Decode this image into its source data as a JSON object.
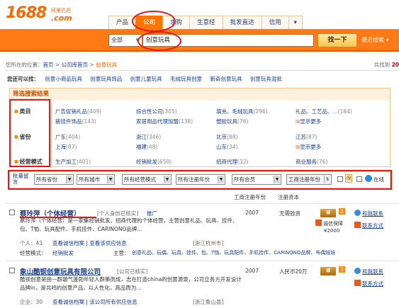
{
  "header": {
    "logo_text": "1688",
    "logo_cn": "阿里巴巴",
    "logo_com": ".com",
    "tabs": [
      "产品",
      "公司",
      "求购",
      "生意经",
      "批发直达",
      "信用",
      "▾"
    ],
    "active_tab": "公司"
  },
  "search": {
    "category": "全部",
    "query": "创意玩具",
    "button": "找一下",
    "recent": "最近搜索 ▾"
  },
  "breadcrumb": {
    "prefix": "您所在的位置：",
    "home": "首页",
    "sep1": " > ",
    "lib": "公司库首页",
    "sep2": " > ",
    "current": "创意玩具"
  },
  "total": {
    "prefix": "共找到",
    "count": "20"
  },
  "want": {
    "label": "您还可以找：",
    "items": [
      "创意小商品玩具",
      "创意玩具饰品",
      "创意儿童玩具",
      "毛绒玩具创意",
      "新奇创意玩具",
      "创意玩具混批"
    ]
  },
  "filter": {
    "title": "筛选搜索结果",
    "category": {
      "label": "类目",
      "items": [
        {
          "name": "广告促销礼品",
          "count": "(409)"
        },
        {
          "name": "综合性公司",
          "count": "(305)"
        },
        {
          "name": "填充、毛绒玩具",
          "count": "(296)"
        },
        {
          "name": "礼品、工艺品、",
          "count": "...(164)"
        },
        {
          "name": "搓挂件饰品",
          "count": "(143)"
        },
        {
          "name": "家居用品代理加盟",
          "count": "(138)"
        },
        {
          "name": "塑胶玩具",
          "count": "(76)"
        },
        {
          "name": "显示更多",
          "count": ""
        }
      ]
    },
    "province": {
      "label": "省份",
      "items": [
        {
          "name": "广东",
          "count": "(404)"
        },
        {
          "name": "浙江",
          "count": "(346)"
        },
        {
          "name": "北京",
          "count": "(88)"
        },
        {
          "name": "江苏",
          "count": "(87)"
        },
        {
          "name": "上海",
          "count": "(87)"
        },
        {
          "name": "福建",
          "count": "(48)"
        },
        {
          "name": "山东",
          "count": "(34)"
        },
        {
          "name": "显示更多",
          "count": ""
        }
      ]
    },
    "mode": {
      "label": "经营模式",
      "items": [
        {
          "name": "生产加工",
          "count": "(401)"
        },
        {
          "name": "经销批发",
          "count": "(650)"
        },
        {
          "name": "招商代理",
          "count": "(32)"
        },
        {
          "name": "商业服务",
          "count": "(76)"
        }
      ]
    }
  },
  "selectbar": {
    "label": "批量留言",
    "dropdowns": [
      "所有省份",
      "所有城市",
      "所有经营模式",
      "所有注册年份",
      "所有会员"
    ],
    "reg_button": "工商注册年份",
    "check1": "",
    "check2": "",
    "online": "在线"
  },
  "columns": {
    "year": "工商注册年份",
    "capital": "注册资本"
  },
  "results": [
    {
      "title": "蔡玲萍（个体经营）",
      "tag": "[个人身份已核实]",
      "extra": "推厂",
      "year": "2007",
      "capital": "无需验资",
      "desc": "蔡玲萍（个体经营）是一家集经销批发、招商代理的个体经营，主营创意礼品、玩具、挂件、包、T恤、玩具配件、手机挂件、CARINONO品牌…",
      "enterprise": "个人：43",
      "enterprise_links": "查看诚信档案 | 查看该供应信息",
      "location": "[浙江杭州市]",
      "mode_label": "经营模式：",
      "mode": "经销批发",
      "main_label": "主营：",
      "main": "创意礼品、玩偶、玩具、挂件、包、T恤、玩具配件、手机挂件、CARINONO品牌、布偶娃娃",
      "actions": [
        "和我联系",
        "联系方式"
      ],
      "assure": "诚信保障",
      "assure_amt": "¥2000"
    },
    {
      "title": "象山酷钡创意玩具有限公司",
      "tag": "[公司已核实]",
      "year": "2007",
      "capital": "人民币20万",
      "desc": "酷钡创意是由一群朝气蓬勃年轻人群策而成，志在打造china的创意源泉，公司立务方开发设计品牌in，是共鸣的创意产品，以人性化，高品质为…",
      "enterprise": "企业：30",
      "enterprise_links": "查看诚信档案 | 该公司所有供应信息",
      "location": "[浙江象山县]",
      "actions": [
        "和我联系",
        "联系方式"
      ]
    }
  ]
}
